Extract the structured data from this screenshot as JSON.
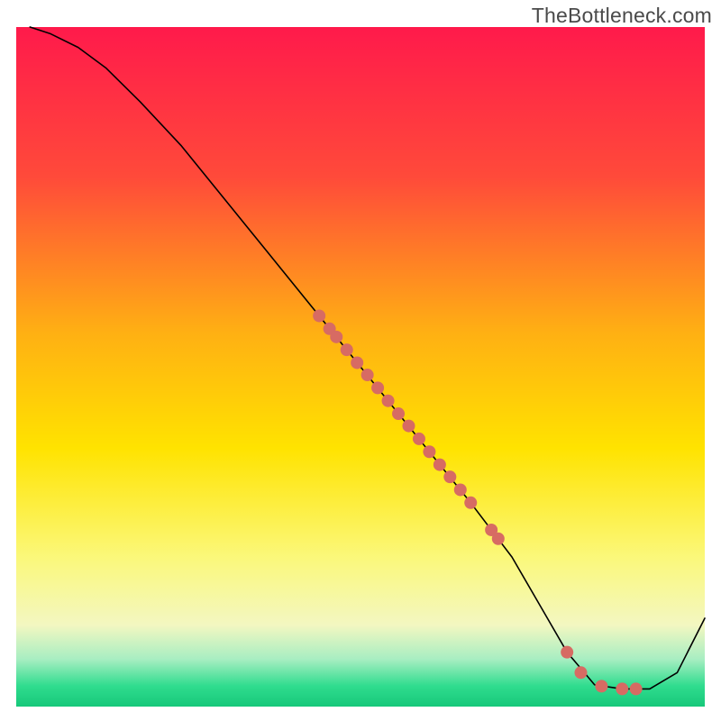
{
  "watermark": "TheBottleneck.com",
  "chart_data": {
    "type": "line",
    "title": "",
    "xlabel": "",
    "ylabel": "",
    "xlim": [
      0,
      100
    ],
    "ylim": [
      0,
      100
    ],
    "grid": false,
    "legend": false,
    "background": {
      "type": "vertical-gradient",
      "stops": [
        {
          "offset": 0.0,
          "color": "#ff1a4b"
        },
        {
          "offset": 0.22,
          "color": "#ff4a3a"
        },
        {
          "offset": 0.45,
          "color": "#ffb013"
        },
        {
          "offset": 0.62,
          "color": "#ffe300"
        },
        {
          "offset": 0.78,
          "color": "#fbf87a"
        },
        {
          "offset": 0.88,
          "color": "#f3f7c1"
        },
        {
          "offset": 0.93,
          "color": "#a8eec2"
        },
        {
          "offset": 0.97,
          "color": "#2fdc8e"
        },
        {
          "offset": 1.0,
          "color": "#17c87a"
        }
      ]
    },
    "series": [
      {
        "name": "bottleneck-curve",
        "type": "line",
        "color": "#000000",
        "width": 1.6,
        "x": [
          2,
          5,
          9,
          13,
          18,
          24,
          30,
          36,
          42,
          48,
          54,
          60,
          66,
          72,
          76,
          80,
          84,
          88,
          92,
          96,
          100
        ],
        "y": [
          100,
          99,
          97,
          94,
          89,
          82.5,
          75,
          67.5,
          60,
          52.5,
          45,
          37.5,
          30,
          22,
          15,
          8,
          3.2,
          2.6,
          2.6,
          5,
          13
        ]
      },
      {
        "name": "sample-points",
        "type": "scatter",
        "color": "#d76b63",
        "radius": 7.0,
        "points": [
          {
            "x": 44,
            "y": 57.5
          },
          {
            "x": 45.5,
            "y": 55.6
          },
          {
            "x": 46.5,
            "y": 54.4
          },
          {
            "x": 48,
            "y": 52.5
          },
          {
            "x": 49.5,
            "y": 50.6
          },
          {
            "x": 51,
            "y": 48.8
          },
          {
            "x": 52.5,
            "y": 46.9
          },
          {
            "x": 54,
            "y": 45.0
          },
          {
            "x": 55.5,
            "y": 43.1
          },
          {
            "x": 57,
            "y": 41.3
          },
          {
            "x": 58.5,
            "y": 39.4
          },
          {
            "x": 60,
            "y": 37.5
          },
          {
            "x": 61.5,
            "y": 35.6
          },
          {
            "x": 63,
            "y": 33.8
          },
          {
            "x": 64.5,
            "y": 31.9
          },
          {
            "x": 66,
            "y": 30.0
          },
          {
            "x": 69,
            "y": 26.0
          },
          {
            "x": 70,
            "y": 24.7
          },
          {
            "x": 80,
            "y": 8.0
          },
          {
            "x": 82,
            "y": 5.0
          },
          {
            "x": 85,
            "y": 3.0
          },
          {
            "x": 88,
            "y": 2.6
          },
          {
            "x": 90,
            "y": 2.6
          }
        ]
      }
    ]
  }
}
